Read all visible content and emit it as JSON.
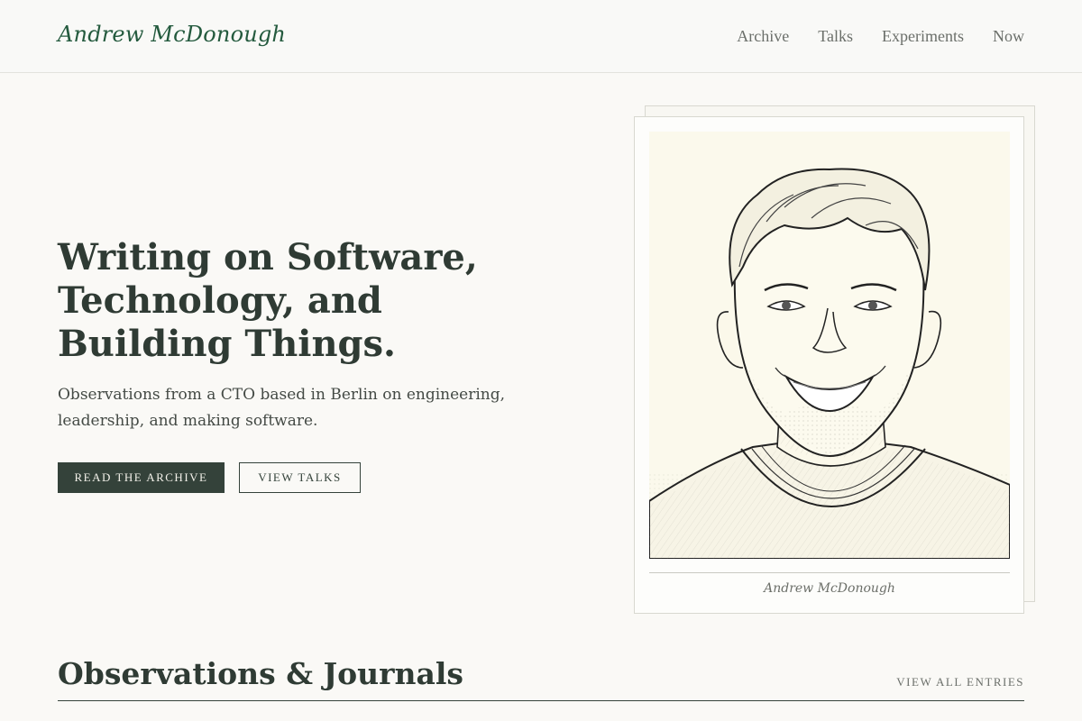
{
  "header": {
    "brand": "Andrew McDonough",
    "nav": [
      "Archive",
      "Talks",
      "Experiments",
      "Now"
    ]
  },
  "hero": {
    "title": "Writing on Software, Technology, and Building Things.",
    "subtitle": "Observations from a CTO based in Berlin on engineering, leadership, and making software.",
    "primary_button": "READ THE ARCHIVE",
    "secondary_button": "VIEW TALKS"
  },
  "portrait": {
    "caption": "Andrew McDonough"
  },
  "journal": {
    "title": "Observations & Journals",
    "view_all": "VIEW ALL ENTRIES"
  },
  "colors": {
    "accent": "#245a3e",
    "ink": "#2f3b34",
    "button_dark": "#34423a",
    "background": "#faf9f6"
  }
}
